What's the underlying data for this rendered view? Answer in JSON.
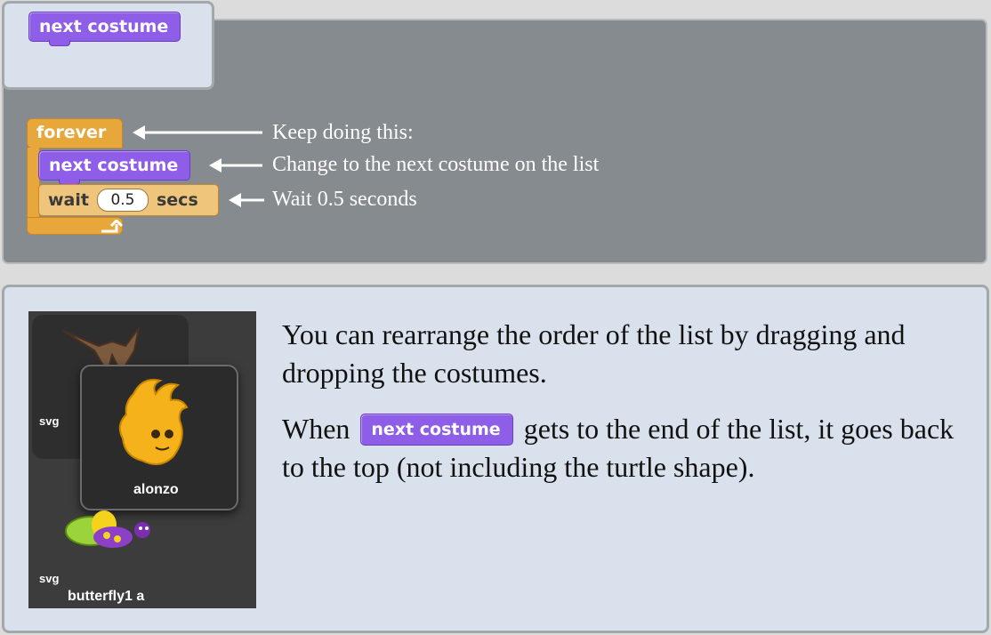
{
  "hint": {
    "block_label": "next costume"
  },
  "script": {
    "forever_label": "forever",
    "next_costume_label": "next costume",
    "wait_label": "wait",
    "wait_value": "0.5",
    "secs_label": "secs"
  },
  "annotations": [
    "Keep doing this:",
    "Change to the next costume on the list",
    "Wait 0.5 seconds"
  ],
  "costumes": [
    {
      "type": "svg",
      "name": ""
    },
    {
      "type": "",
      "name": "alonzo"
    },
    {
      "type": "svg",
      "name": "butterfly1 a"
    }
  ],
  "explanation": {
    "para1": "You can rearrange the order of the list by dragging and dropping the costumes.",
    "para2_before": "When",
    "para2_block": "next costume",
    "para2_after": "gets to the end of the list, it goes back to the top (not including the turtle shape)."
  },
  "colors": {
    "motion_purple": "#8e5ee8",
    "control_orange": "#e7a73a",
    "panel_gray": "#858b8e",
    "panel_light": "#d9e2ec"
  }
}
